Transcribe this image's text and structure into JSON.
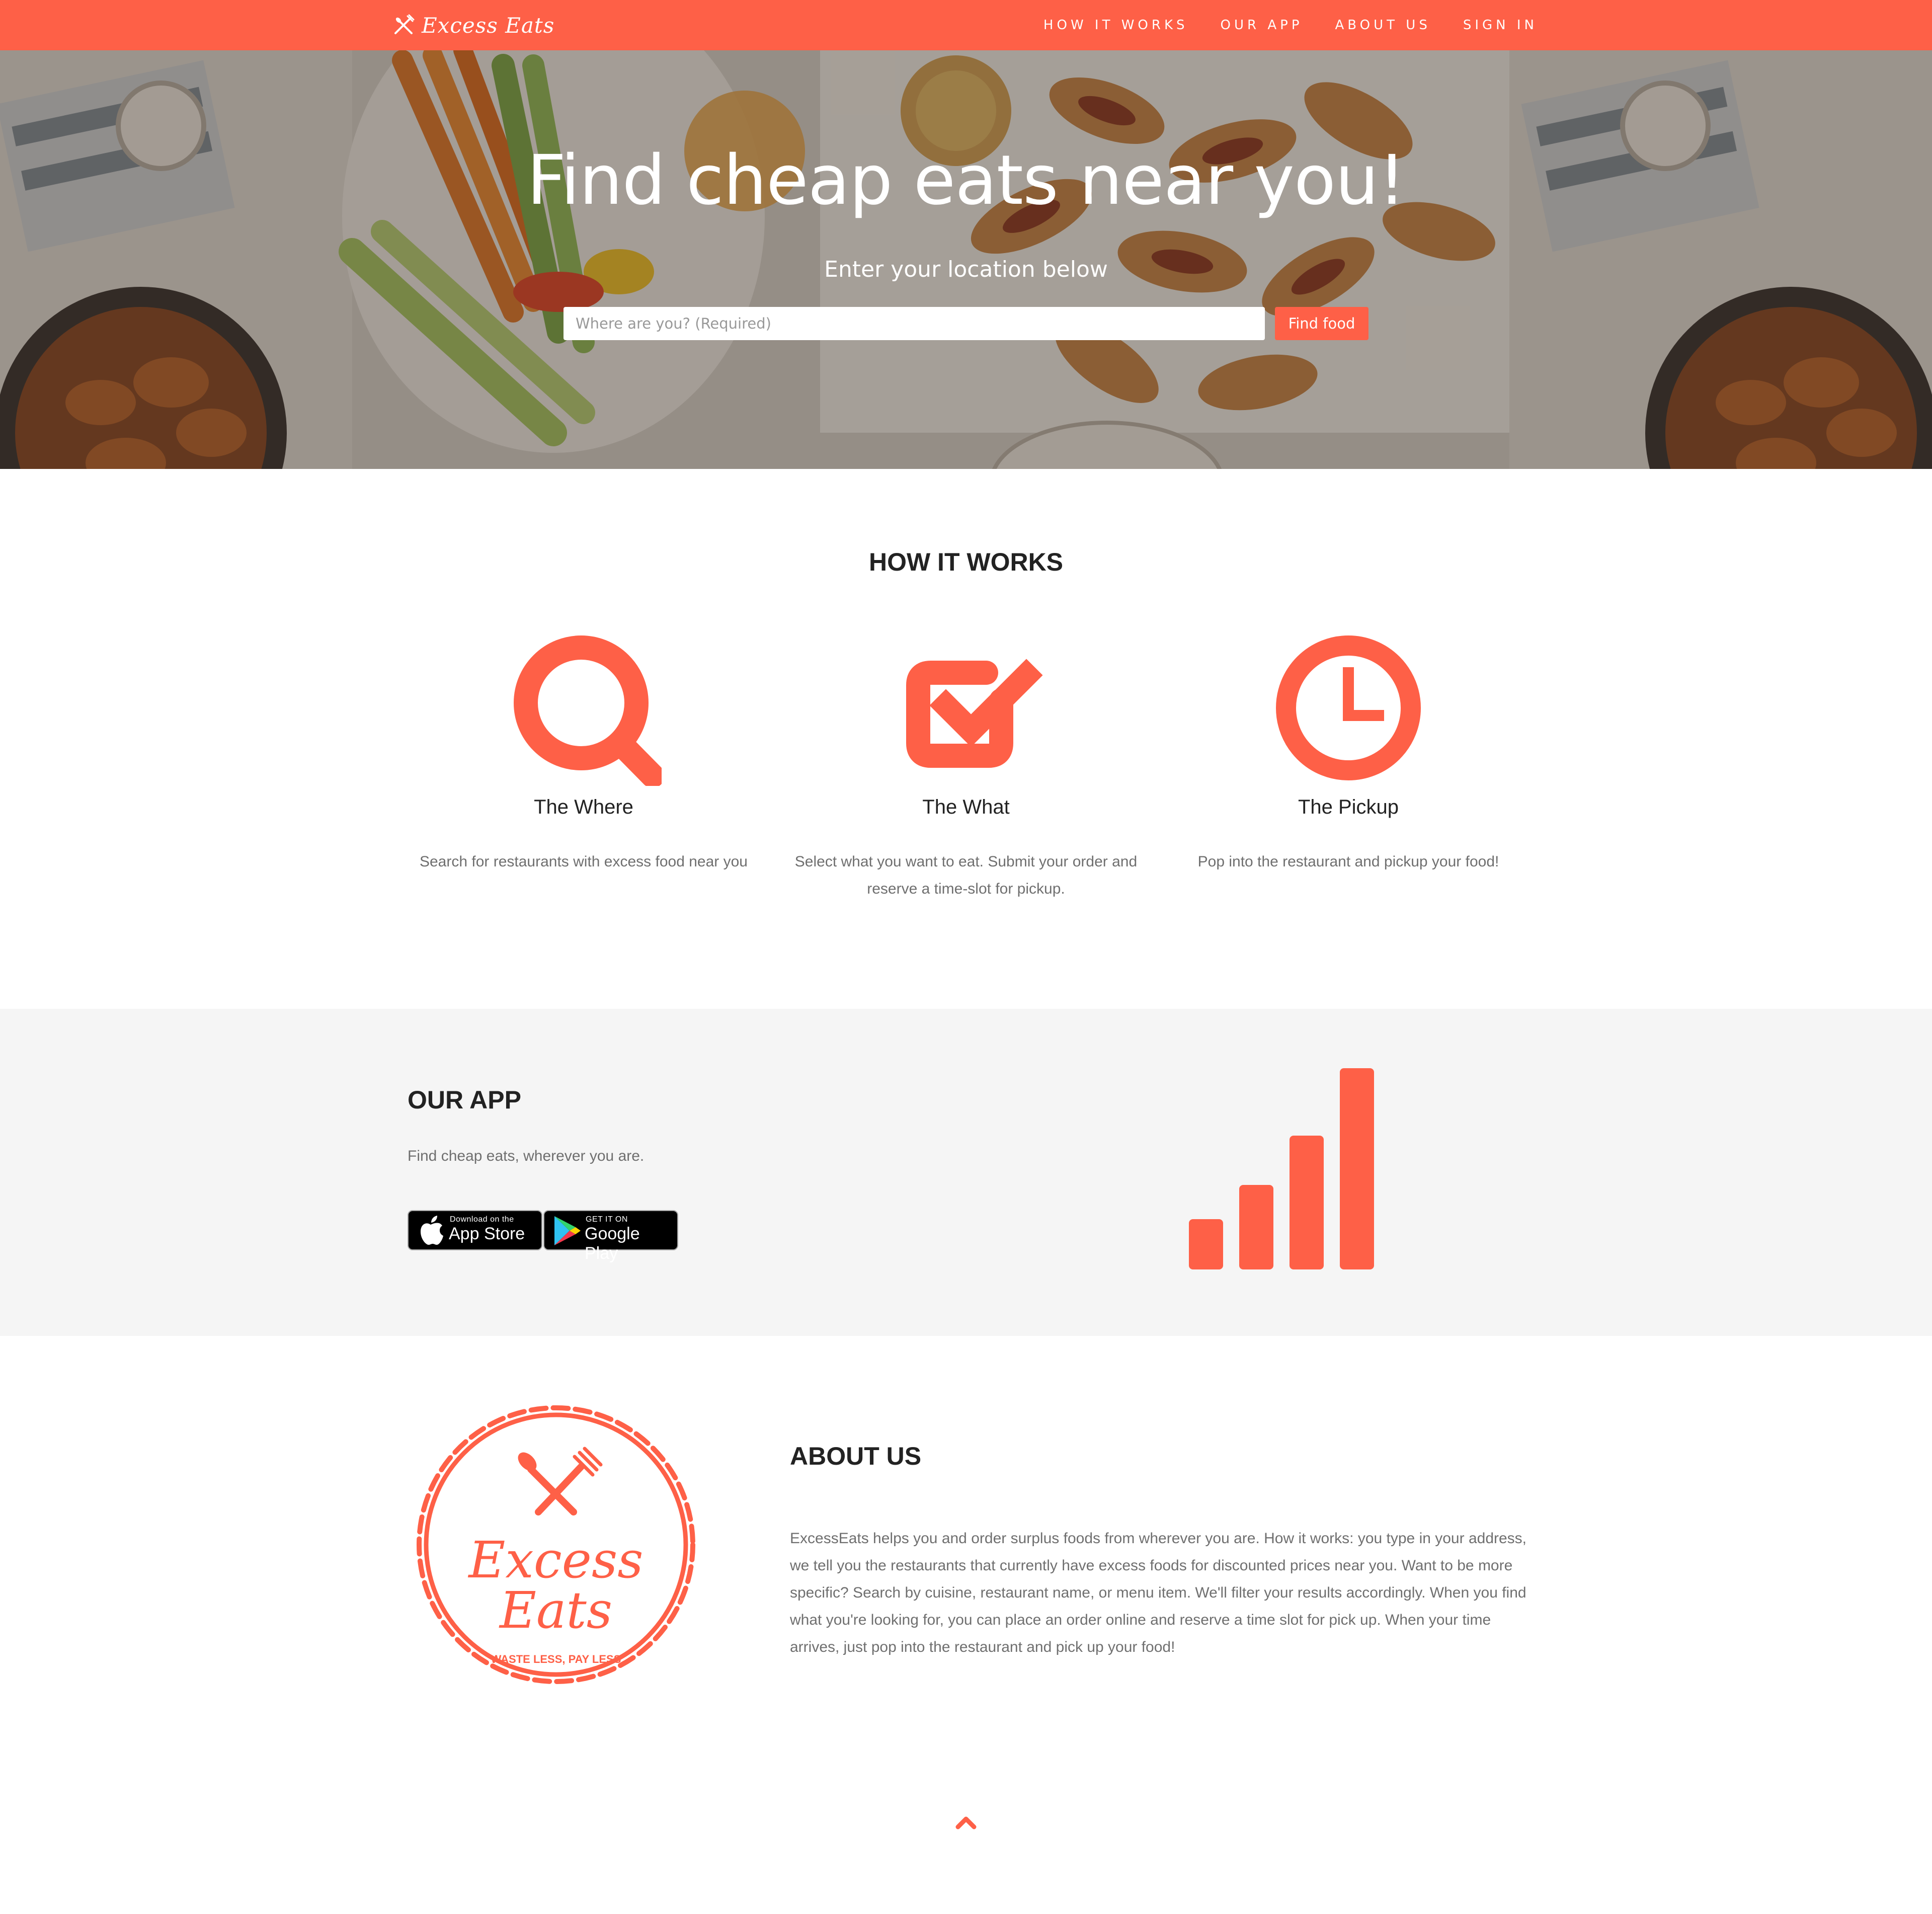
{
  "nav": {
    "brand": "Excess Eats",
    "links": [
      "HOW IT WORKS",
      "OUR APP",
      "ABOUT US",
      "SIGN IN"
    ]
  },
  "hero": {
    "title": "Find cheap eats near you!",
    "subtitle": "Enter your location below",
    "search_placeholder": "Where are you? (Required)",
    "button_label": "Find food"
  },
  "how_it_works": {
    "heading": "HOW IT WORKS",
    "features": [
      {
        "icon": "search-icon",
        "title": "The Where",
        "description": "Search for restaurants with excess food near you"
      },
      {
        "icon": "checkbox-icon",
        "title": "The What",
        "description": "Select what you want to eat. Submit your order and reserve a time-slot for pickup."
      },
      {
        "icon": "clock-icon",
        "title": "The Pickup",
        "description": "Pop into the restaurant and pickup your food!"
      }
    ]
  },
  "our_app": {
    "heading": "OUR APP",
    "text": "Find cheap eats, wherever you are.",
    "app_store": {
      "small": "Download on the",
      "big": "App Store"
    },
    "google_play": {
      "small": "GET IT ON",
      "big": "Google Play"
    },
    "graphic": "signal-bars-icon"
  },
  "about": {
    "heading": "ABOUT US",
    "logo": {
      "line1": "Excess",
      "line2": "Eats",
      "tagline": "WASTE LESS, PAY LESS"
    },
    "text": "ExcessEats helps you and order surplus foods from wherever you are. How it works: you type in your address, we tell you the restaurants that currently have excess foods for discounted prices near you. Want to be more specific? Search by cuisine, restaurant name, or menu item. We'll filter your results accordingly. When you find what you're looking for, you can place an order online and reserve a time slot for pick up. When your time arrives, just pop into the restaurant and pick up your food!"
  },
  "colors": {
    "accent": "#fe6047",
    "app_background": "#f5f5f5",
    "body_text": "#6f6f6f",
    "heading_text": "#222222"
  }
}
